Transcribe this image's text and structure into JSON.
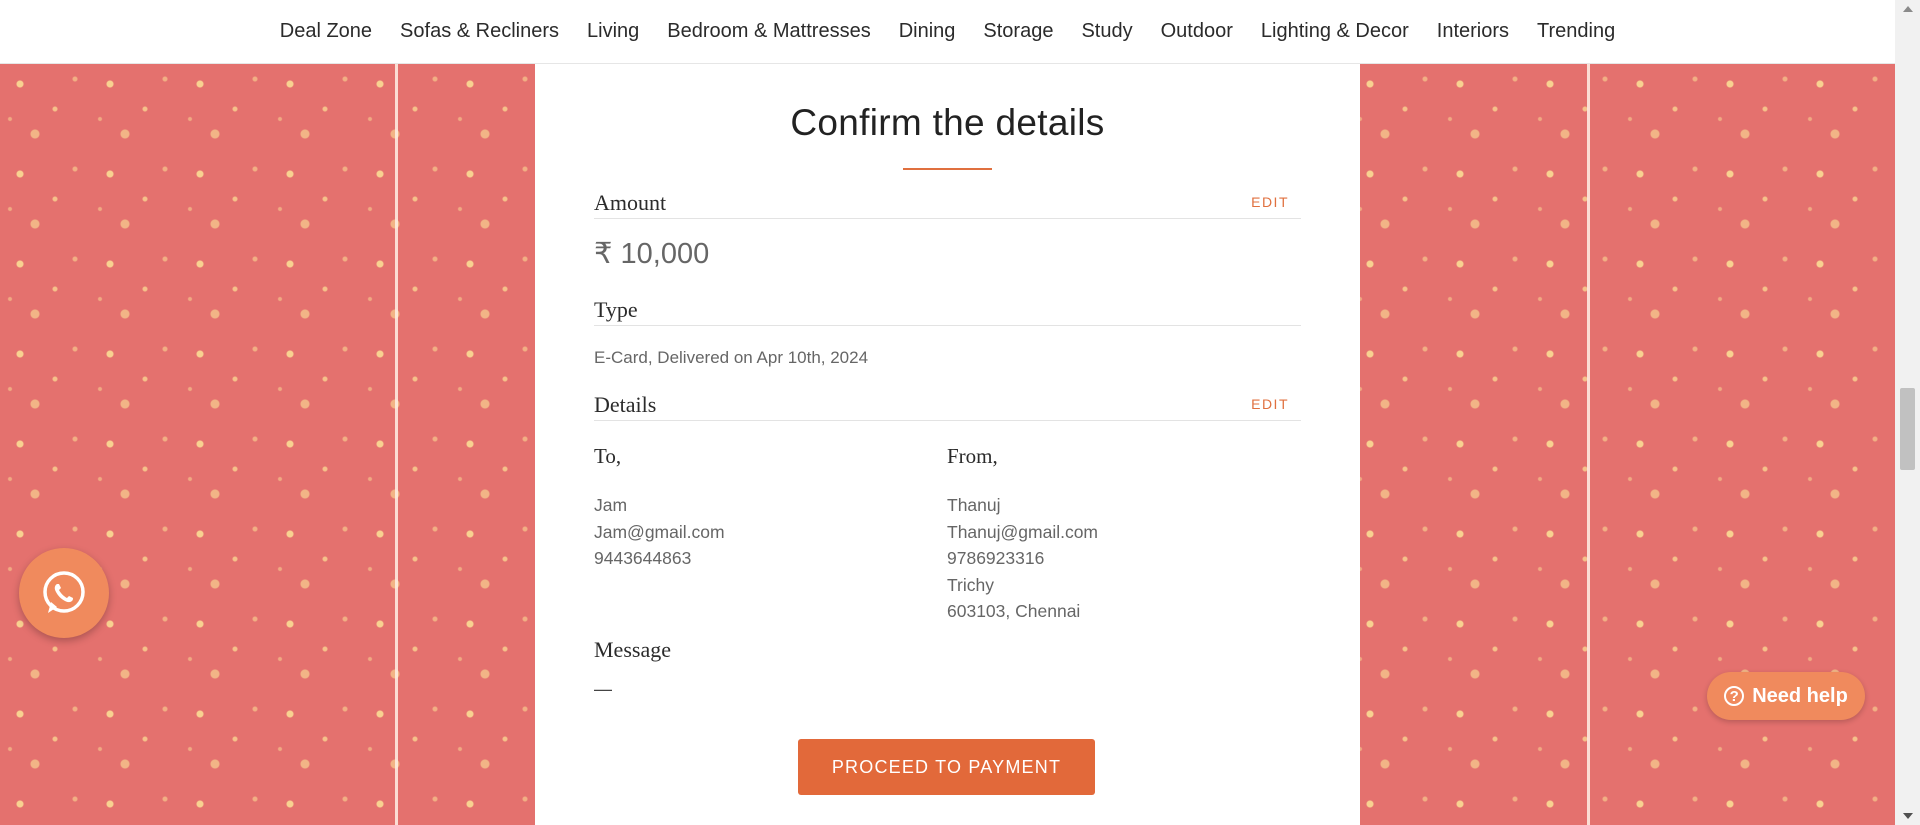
{
  "nav": {
    "items": [
      "Deal Zone",
      "Sofas & Recliners",
      "Living",
      "Bedroom & Mattresses",
      "Dining",
      "Storage",
      "Study",
      "Outdoor",
      "Lighting & Decor",
      "Interiors",
      "Trending"
    ]
  },
  "confirm": {
    "title": "Confirm the details",
    "amount": {
      "label": "Amount",
      "edit": "EDIT",
      "value": "₹ 10,000"
    },
    "type": {
      "label": "Type",
      "value": "E-Card, Delivered on Apr 10th, 2024"
    },
    "details": {
      "label": "Details",
      "edit": "EDIT",
      "to": {
        "heading": "To,",
        "lines": [
          "Jam",
          "Jam@gmail.com",
          "9443644863"
        ]
      },
      "from": {
        "heading": "From,",
        "lines": [
          "Thanuj",
          "Thanuj@gmail.com",
          "9786923316",
          "Trichy",
          "603103, Chennai"
        ]
      }
    },
    "message": {
      "label": "Message",
      "value": "—"
    },
    "proceed_label": "PROCEED TO PAYMENT"
  },
  "floating": {
    "whatsapp_icon": "whatsapp-icon",
    "help_label": "Need help",
    "help_icon_glyph": "?"
  },
  "colors": {
    "accent": "#e2693a",
    "pattern_bg": "#e4716e",
    "pattern_ink": "#fce296"
  }
}
